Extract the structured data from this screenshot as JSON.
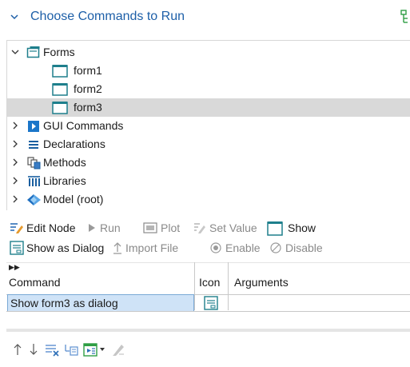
{
  "header": {
    "title": "Choose Commands to Run"
  },
  "tree": {
    "items": [
      {
        "label": "Forms",
        "icon": "forms-folder-icon",
        "expanded": true
      },
      {
        "label": "form1",
        "icon": "form-icon"
      },
      {
        "label": "form2",
        "icon": "form-icon"
      },
      {
        "label": "form3",
        "icon": "form-icon",
        "selected": true
      },
      {
        "label": "GUI Commands",
        "icon": "gui-commands-icon"
      },
      {
        "label": "Declarations",
        "icon": "declarations-icon"
      },
      {
        "label": "Methods",
        "icon": "methods-icon"
      },
      {
        "label": "Libraries",
        "icon": "libraries-icon"
      },
      {
        "label": "Model (root)",
        "icon": "model-root-icon"
      }
    ]
  },
  "toolbar": {
    "edit_node": "Edit Node",
    "run": "Run",
    "plot": "Plot",
    "set_value": "Set Value",
    "show": "Show",
    "show_as_dialog": "Show as Dialog",
    "import_file": "Import File",
    "enable": "Enable",
    "disable": "Disable"
  },
  "grid": {
    "columns": [
      "Command",
      "Icon",
      "Arguments"
    ],
    "rows": [
      {
        "command": "Show form3 as dialog",
        "icon": "dialog-icon",
        "arguments": ""
      }
    ]
  },
  "colors": {
    "accent": "#1d5fa8",
    "selection": "#d9d9d9",
    "cell_selection": "#cfe3f7",
    "icon_teal": "#1e7f8c",
    "icon_green": "#2f9e44"
  }
}
